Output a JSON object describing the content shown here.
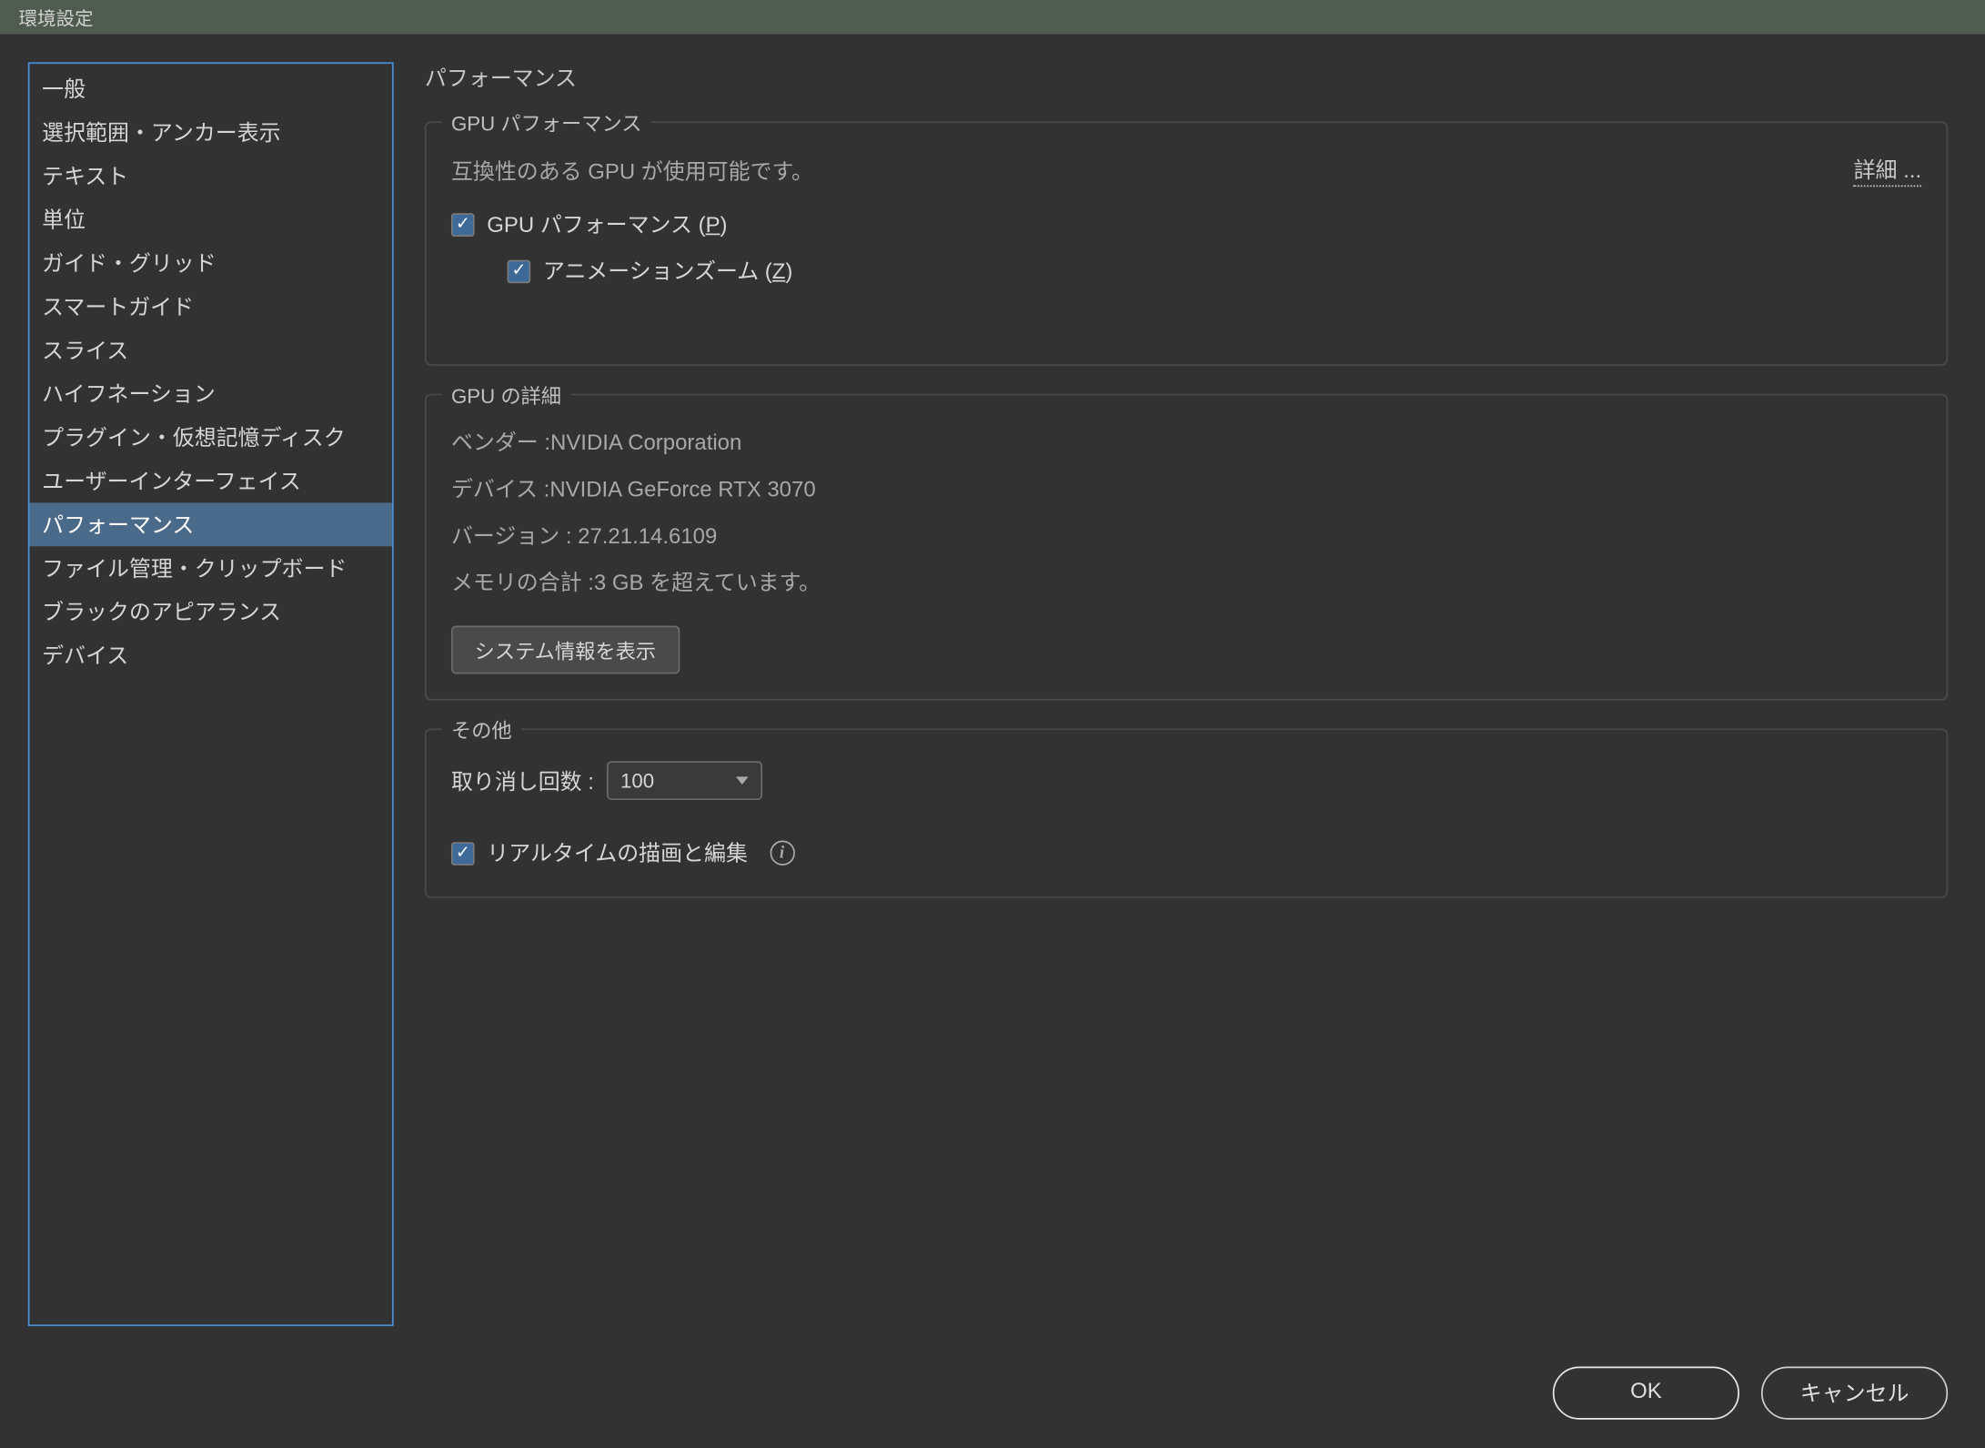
{
  "titlebar": {
    "title": "環境設定"
  },
  "sidebar": {
    "items": [
      {
        "label": "一般",
        "name": "sidebar-item-general"
      },
      {
        "label": "選択範囲・アンカー表示",
        "name": "sidebar-item-selection-anchor"
      },
      {
        "label": "テキスト",
        "name": "sidebar-item-text"
      },
      {
        "label": "単位",
        "name": "sidebar-item-units"
      },
      {
        "label": "ガイド・グリッド",
        "name": "sidebar-item-guides-grid"
      },
      {
        "label": "スマートガイド",
        "name": "sidebar-item-smart-guides"
      },
      {
        "label": "スライス",
        "name": "sidebar-item-slices"
      },
      {
        "label": "ハイフネーション",
        "name": "sidebar-item-hyphenation"
      },
      {
        "label": "プラグイン・仮想記憶ディスク",
        "name": "sidebar-item-plugins-scratch"
      },
      {
        "label": "ユーザーインターフェイス",
        "name": "sidebar-item-ui"
      },
      {
        "label": "パフォーマンス",
        "name": "sidebar-item-performance",
        "selected": true
      },
      {
        "label": "ファイル管理・クリップボード",
        "name": "sidebar-item-file-clipboard"
      },
      {
        "label": "ブラックのアピアランス",
        "name": "sidebar-item-black-appearance"
      },
      {
        "label": "デバイス",
        "name": "sidebar-item-devices"
      }
    ]
  },
  "main": {
    "title": "パフォーマンス",
    "gpu_perf": {
      "legend": "GPU パフォーマンス",
      "availability": "互換性のある GPU が使用可能です。",
      "details_link": "詳細 ...",
      "gpu_perf_label_pre": "GPU パフォーマンス (",
      "gpu_perf_hotkey": "P",
      "gpu_perf_label_post": ")",
      "anim_zoom_label_pre": "アニメーションズーム (",
      "anim_zoom_hotkey": "Z",
      "anim_zoom_label_post": ")"
    },
    "gpu_details": {
      "legend": "GPU の詳細",
      "vendor": "ベンダー :NVIDIA Corporation",
      "device": "デバイス :NVIDIA GeForce RTX 3070",
      "version": "バージョン : 27.21.14.6109",
      "memory": "メモリの合計 :3 GB を超えています。",
      "sysinfo_button": "システム情報を表示"
    },
    "other": {
      "legend": "その他",
      "undo_label": "取り消し回数 :",
      "undo_value": "100",
      "realtime_label": "リアルタイムの描画と編集"
    }
  },
  "footer": {
    "ok": "OK",
    "cancel": "キャンセル"
  }
}
